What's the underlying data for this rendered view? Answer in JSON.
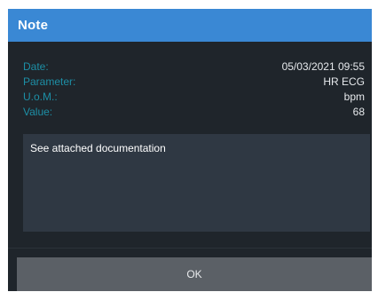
{
  "dialog": {
    "title": "Note",
    "fields": [
      {
        "label": "Date:",
        "value": "05/03/2021 09:55"
      },
      {
        "label": "Parameter:",
        "value": "HR ECG"
      },
      {
        "label": "U.o.M.:",
        "value": "bpm"
      },
      {
        "label": "Value:",
        "value": "68"
      }
    ],
    "note_text": "See attached documentation",
    "ok_label": "OK"
  },
  "colors": {
    "titlebar": "#3a88d4",
    "background": "#1f252b",
    "label": "#1d8fa6",
    "note_box": "#2f3843",
    "button": "#5b6066"
  }
}
